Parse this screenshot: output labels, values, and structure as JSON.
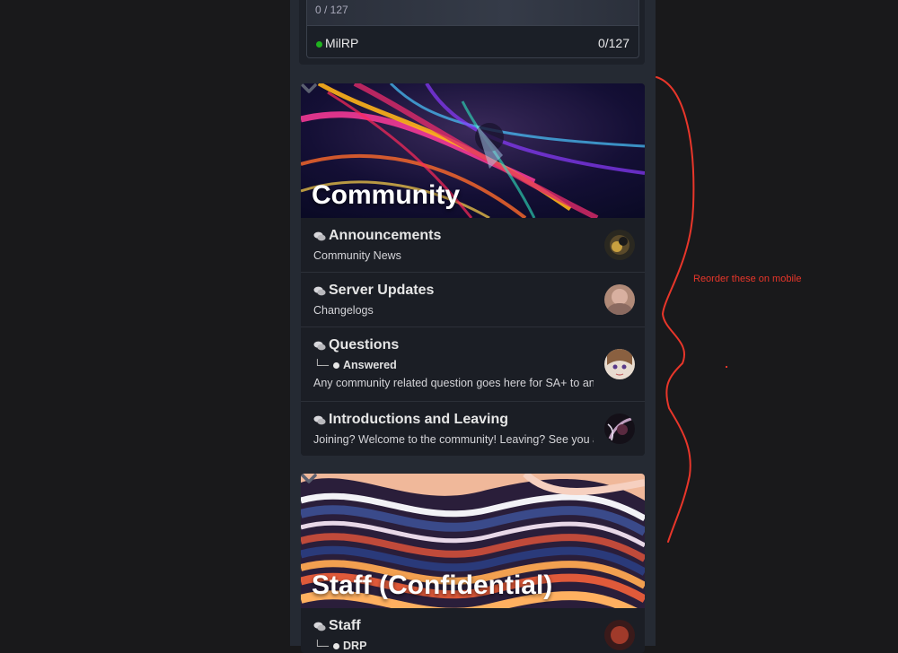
{
  "server": {
    "strip_text": "0 / 127",
    "name": "MilRP",
    "count": "0/127",
    "status_color": "#1fb31f"
  },
  "community": {
    "title": "Community",
    "forums": [
      {
        "title": "Announcements",
        "description": "Community News",
        "icon": "chat-bubbles-icon"
      },
      {
        "title": "Server Updates",
        "description": "Changelogs",
        "icon": "chat-bubbles-icon"
      },
      {
        "title": "Questions",
        "subforum": "Answered",
        "description": "Any community related question goes here for SA+ to answer",
        "icon": "chat-bubbles-icon"
      },
      {
        "title": "Introductions and Leaving",
        "description": "Joining? Welcome to the community! Leaving? See you around!",
        "icon": "chat-bubbles-icon"
      }
    ]
  },
  "staff": {
    "title": "Staff (Confidential)",
    "forums": [
      {
        "title": "Staff",
        "subforum": "DRP",
        "icon": "chat-bubbles-icon"
      }
    ]
  },
  "annotation": {
    "text": "Reorder these on mobile",
    "color": "#e8362a"
  },
  "colors": {
    "page_bg": "#19191b",
    "column_bg": "#252a33",
    "forum_bg": "#1b1e25"
  }
}
